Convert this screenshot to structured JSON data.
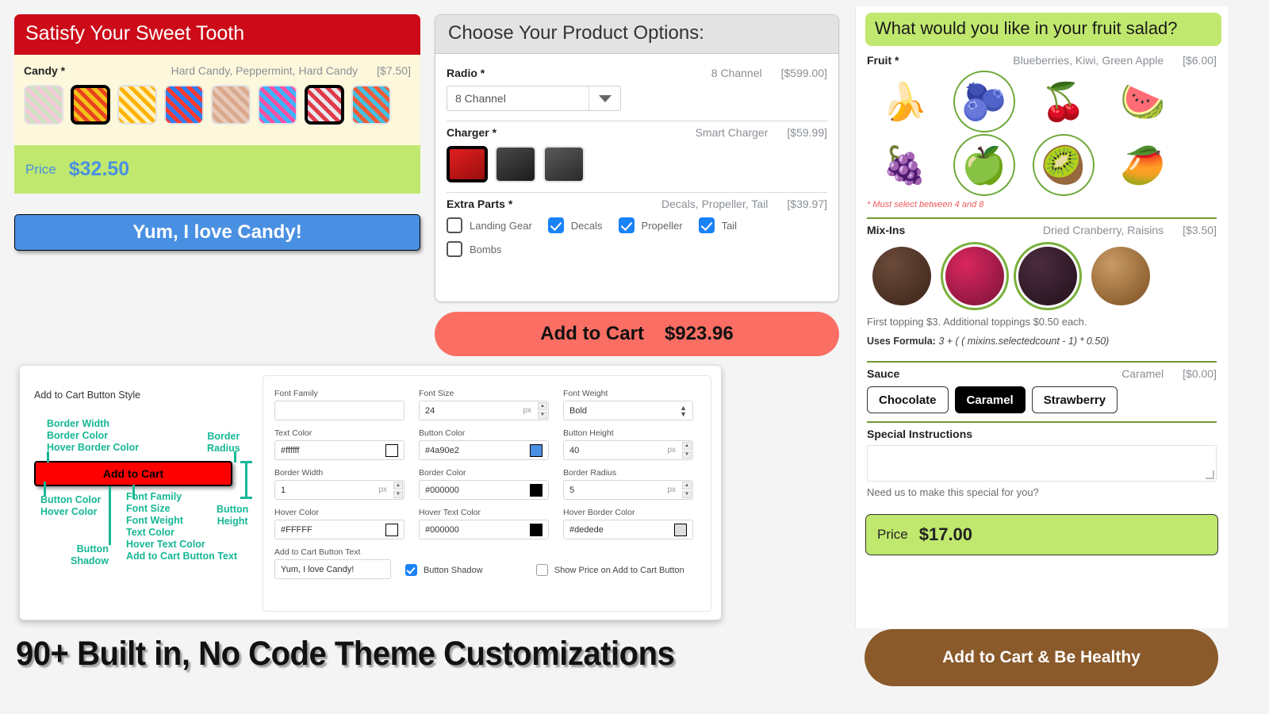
{
  "candy": {
    "title": "Satisfy Your Sweet Tooth",
    "option_label": "Candy *",
    "selected_text": "Hard Candy, Peppermint, Hard Candy",
    "price_tag": "[$7.50]",
    "swatches": [
      {
        "name": "pastel-mix-candy",
        "selected": false,
        "c1": "#f2c9d8",
        "c2": "#cfe2c2"
      },
      {
        "name": "assorted-hard-candy",
        "selected": true,
        "c1": "#e8431f",
        "c2": "#f3c21a"
      },
      {
        "name": "candy-corn",
        "selected": false,
        "c1": "#ffb300",
        "c2": "#fff3c4"
      },
      {
        "name": "sprinkles-mix",
        "selected": false,
        "c1": "#ff3b30",
        "c2": "#2f7df6"
      },
      {
        "name": "gummy-mix",
        "selected": false,
        "c1": "#e8c9b8",
        "c2": "#d9a98e"
      },
      {
        "name": "rainbow-sprinkles",
        "selected": false,
        "c1": "#ff4fa3",
        "c2": "#3bb3ff"
      },
      {
        "name": "peppermint-candy-canes",
        "selected": true,
        "c1": "#e8e8ee",
        "c2": "#e03a4a"
      },
      {
        "name": "sour-worms",
        "selected": false,
        "c1": "#f15a38",
        "c2": "#46c0e0"
      }
    ],
    "price_label": "Price",
    "price_value": "$32.50",
    "cta_label": "Yum, I love Candy!"
  },
  "product": {
    "title": "Choose Your Product Options:",
    "sections": [
      {
        "label": "Radio *",
        "selected_text": "8 Channel",
        "price_tag": "[$599.00]",
        "control": "select",
        "select_value": "8 Channel"
      },
      {
        "label": "Charger *",
        "selected_text": "Smart Charger",
        "price_tag": "[$59.99]",
        "control": "swatches",
        "swatches": [
          {
            "name": "smart-charger-red",
            "selected": true,
            "c1": "#e02020",
            "c2": "#9b0d0d"
          },
          {
            "name": "balance-charger-black",
            "selected": false,
            "c1": "#4a4a4a",
            "c2": "#1c1c1c"
          },
          {
            "name": "compact-charger-grey",
            "selected": false,
            "c1": "#5a5a5a",
            "c2": "#2a2a2a"
          }
        ]
      },
      {
        "label": "Extra Parts *",
        "selected_text": "Decals, Propeller, Tail",
        "price_tag": "[$39.97]",
        "control": "checkboxes",
        "checkboxes": [
          {
            "label": "Landing Gear",
            "checked": false
          },
          {
            "label": "Decals",
            "checked": true
          },
          {
            "label": "Propeller",
            "checked": true
          },
          {
            "label": "Tail",
            "checked": true
          },
          {
            "label": "Bombs",
            "checked": false
          }
        ]
      }
    ],
    "cta_label": "Add to Cart",
    "cta_price": "$923.96"
  },
  "fruit": {
    "title": "What would you like in your fruit salad?",
    "fruit_label": "Fruit *",
    "fruit_selected_text": "Blueberries, Kiwi, Green Apple",
    "fruit_price_tag": "[$6.00]",
    "fruits": [
      {
        "name": "banana",
        "selected": false,
        "glyph": "🍌"
      },
      {
        "name": "blueberries",
        "selected": true,
        "glyph": "🫐"
      },
      {
        "name": "cherries",
        "selected": false,
        "glyph": "🍒"
      },
      {
        "name": "watermelon",
        "selected": false,
        "glyph": "🍉"
      },
      {
        "name": "green-grapes",
        "selected": false,
        "glyph": "🍇"
      },
      {
        "name": "green-apple",
        "selected": true,
        "glyph": "🍏"
      },
      {
        "name": "kiwi",
        "selected": true,
        "glyph": "🥝"
      },
      {
        "name": "mango",
        "selected": false,
        "glyph": "🥭"
      }
    ],
    "fruit_note": "* Must select between 4 and 8",
    "mixins_label": "Mix-Ins",
    "mixins_selected_text": "Dried Cranberry, Raisins",
    "mixins_price_tag": "[$3.50]",
    "mixins": [
      {
        "name": "chocolate-chips",
        "selected": false,
        "c1": "#6b4a3a",
        "c2": "#3a2418"
      },
      {
        "name": "dried-cranberry",
        "selected": true,
        "c1": "#d9275f",
        "c2": "#7a1238"
      },
      {
        "name": "raisins",
        "selected": true,
        "c1": "#4a2b3d",
        "c2": "#23111c"
      },
      {
        "name": "almonds",
        "selected": false,
        "c1": "#c89a63",
        "c2": "#7c4f22"
      }
    ],
    "mixins_note": "First topping $3. Additional toppings $0.50 each.",
    "formula_label": "Uses Formula:",
    "formula_value": "3 + ( ( mixins.selectedcount - 1) * 0.50)",
    "sauce_label": "Sauce",
    "sauce_selected_text": "Caramel",
    "sauce_price_tag": "[$0.00]",
    "sauces": [
      {
        "label": "Chocolate",
        "selected": false
      },
      {
        "label": "Caramel",
        "selected": true
      },
      {
        "label": "Strawberry",
        "selected": false
      }
    ],
    "special_label": "Special Instructions",
    "special_value": "",
    "special_note": "Need us to make this special for you?",
    "price_label": "Price",
    "price_value": "$17.00",
    "cta_label": "Add to Cart & Be Healthy"
  },
  "theme": {
    "diagram_title": "Add to Cart Button Style",
    "diagram_button_text": "Add to Cart",
    "annotations": {
      "top_left": "Border Width\nBorder Color\nHover Border Color",
      "top_right": "Border\nRadius",
      "bottom_left": "Button Color\nHover Color",
      "bottom_center": "Font Family\nFont Size\nFont Weight\nText Color\nHover Text Color\nAdd to Cart Button Text",
      "bottom_shadow": "Button\nShadow",
      "bottom_right": "Button\nHeight"
    },
    "fields": [
      {
        "label": "Font Family",
        "value": "",
        "kind": "text"
      },
      {
        "label": "Font Size",
        "value": "24",
        "unit": "px",
        "kind": "spin"
      },
      {
        "label": "Font Weight",
        "value": "Bold",
        "kind": "select"
      },
      {
        "label": "Text Color",
        "value": "#ffffff",
        "kind": "color",
        "swatch": "#ffffff"
      },
      {
        "label": "Button Color",
        "value": "#4a90e2",
        "kind": "color",
        "swatch": "#4a90e2"
      },
      {
        "label": "Button Height",
        "value": "40",
        "unit": "px",
        "kind": "spin"
      },
      {
        "label": "Border Width",
        "value": "1",
        "unit": "px",
        "kind": "spin"
      },
      {
        "label": "Border Color",
        "value": "#000000",
        "kind": "color",
        "swatch": "#000000"
      },
      {
        "label": "Border Radius",
        "value": "5",
        "unit": "px",
        "kind": "spin"
      },
      {
        "label": "Hover Color",
        "value": "#FFFFF",
        "kind": "color",
        "swatch": "#ffffff"
      },
      {
        "label": "Hover Text Color",
        "value": "#000000",
        "kind": "color",
        "swatch": "#000000"
      },
      {
        "label": "Hover Border Color",
        "value": "#dedede",
        "kind": "color",
        "swatch": "#dedede"
      }
    ],
    "button_text_label": "Add to Cart Button Text",
    "button_text_value": "Yum, I love Candy!",
    "button_shadow_label": "Button Shadow",
    "button_shadow_checked": true,
    "show_price_label": "Show Price on Add to Cart Button",
    "show_price_checked": false
  },
  "headline": "90+ Built in, No Code Theme Customizations",
  "colors": {
    "candy_header": "#cc0a18",
    "candy_body": "#fdf8dc",
    "green_price": "#c0e86e",
    "blue_cta": "#4a90e2",
    "red_cta": "#fa6e64",
    "brown_cta": "#8a5a2b",
    "annotation_teal": "#16b795"
  }
}
